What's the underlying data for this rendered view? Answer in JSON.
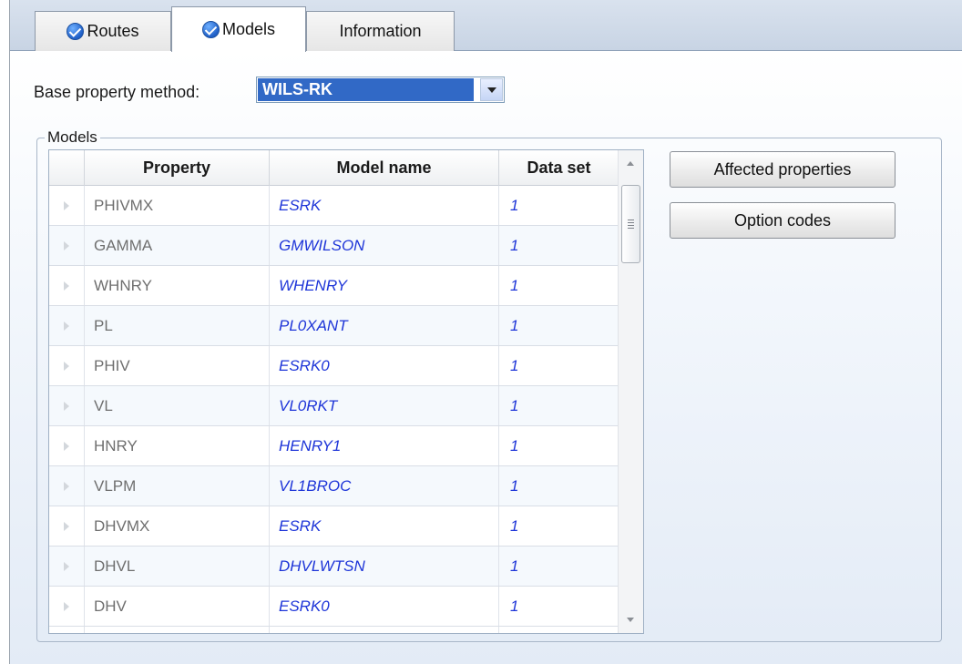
{
  "tabs": [
    {
      "label": "Routes",
      "checked": true,
      "active": false
    },
    {
      "label": "Models",
      "checked": true,
      "active": true
    },
    {
      "label": "Information",
      "checked": false,
      "active": false
    }
  ],
  "base_property": {
    "label": "Base property method:",
    "value": "WILS-RK"
  },
  "models_group": {
    "title": "Models",
    "columns": [
      "Property",
      "Model name",
      "Data set"
    ],
    "rows": [
      {
        "property": "PHIVMX",
        "model": "ESRK",
        "data_set": "1"
      },
      {
        "property": "GAMMA",
        "model": "GMWILSON",
        "data_set": "1"
      },
      {
        "property": "WHNRY",
        "model": "WHENRY",
        "data_set": "1"
      },
      {
        "property": "PL",
        "model": "PL0XANT",
        "data_set": "1"
      },
      {
        "property": "PHIV",
        "model": "ESRK0",
        "data_set": "1"
      },
      {
        "property": "VL",
        "model": "VL0RKT",
        "data_set": "1"
      },
      {
        "property": "HNRY",
        "model": "HENRY1",
        "data_set": "1"
      },
      {
        "property": "VLPM",
        "model": "VL1BROC",
        "data_set": "1"
      },
      {
        "property": "DHVMX",
        "model": "ESRK",
        "data_set": "1"
      },
      {
        "property": "DHVL",
        "model": "DHVLWTSN",
        "data_set": "1"
      },
      {
        "property": "DHV",
        "model": "ESRK0",
        "data_set": "1"
      }
    ]
  },
  "buttons": {
    "affected": "Affected properties",
    "option_codes": "Option codes"
  },
  "colors": {
    "selection": "#3169c6",
    "link_text": "#1e35d8",
    "check_icon": "#1f5fc7"
  }
}
